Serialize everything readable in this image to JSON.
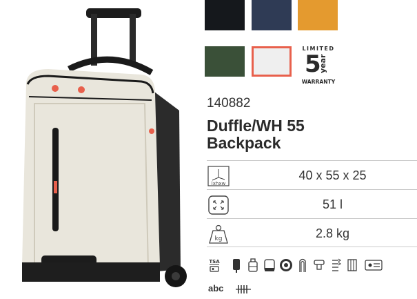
{
  "product": {
    "sku": "140882",
    "title_line1": "Duffle/WH 55",
    "title_line2": "Backpack",
    "image_icon": "suitcase-backpack-image"
  },
  "swatches": [
    {
      "name": "black",
      "color": "#15181c",
      "selected": false
    },
    {
      "name": "navy",
      "color": "#2f3b55",
      "selected": false
    },
    {
      "name": "orange",
      "color": "#e49a2f",
      "selected": false
    },
    {
      "name": "green",
      "color": "#3a5038",
      "selected": false
    },
    {
      "name": "white",
      "color": "#efefef",
      "selected": true
    }
  ],
  "warranty": {
    "limited": "LIMITED",
    "years": "5",
    "year_word": "year",
    "warranty_word": "WARRANTY"
  },
  "specs": {
    "dimensions_icon_label": "lxhxw",
    "dimensions": "40 x 55 x 25",
    "volume": "51 l",
    "weight_icon_label": "kg",
    "weight": "2.8 kg"
  },
  "features": {
    "tsa_label": "TSA",
    "abc_label": "abc",
    "icons": [
      "tsa-lock-icon",
      "lock-icon",
      "luggage-icon",
      "bag-icon",
      "wheel-icon",
      "backpack-strap-icon",
      "handle-icon",
      "expander-icon",
      "fold-icon",
      "id-card-icon",
      "abc-label-icon",
      "zipper-icon"
    ]
  },
  "colors": {
    "accent": "#e8604c",
    "text": "#2b2b2b"
  }
}
